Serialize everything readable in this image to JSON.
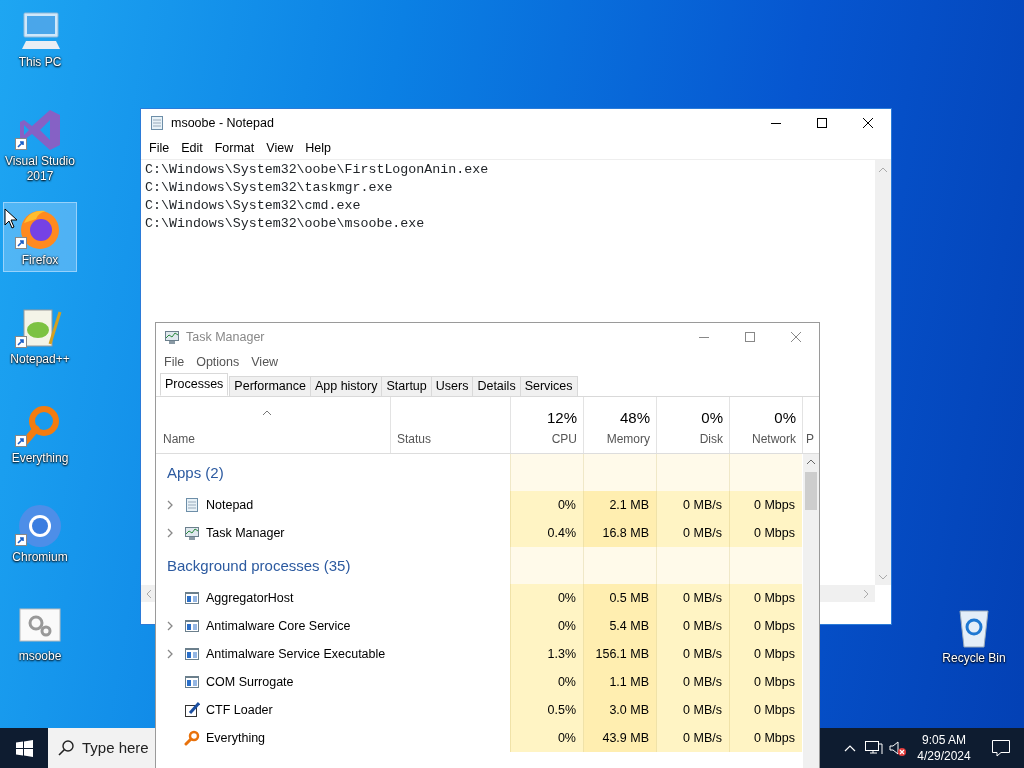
{
  "desktop_icons": [
    {
      "label": "This PC",
      "kind": "computer",
      "shortcut": false,
      "selected": false
    },
    {
      "label": "Visual Studio 2017",
      "kind": "ribbon",
      "shortcut": true,
      "selected": false
    },
    {
      "label": "Firefox",
      "kind": "fox",
      "shortcut": true,
      "selected": true
    },
    {
      "label": "Notepad++",
      "kind": "notepadpp",
      "shortcut": true,
      "selected": false
    },
    {
      "label": "Everything",
      "kind": "magnifier",
      "shortcut": true,
      "selected": false
    },
    {
      "label": "Chromium",
      "kind": "chrome",
      "shortcut": true,
      "selected": false
    },
    {
      "label": "msoobe",
      "kind": "gears",
      "shortcut": false,
      "selected": false
    }
  ],
  "recycle_bin": {
    "label": "Recycle Bin"
  },
  "notepad": {
    "title": "msoobe - Notepad",
    "menu": [
      "File",
      "Edit",
      "Format",
      "View",
      "Help"
    ],
    "lines": [
      "C:\\Windows\\System32\\oobe\\FirstLogonAnin.exe",
      "C:\\Windows\\System32\\taskmgr.exe",
      "C:\\Windows\\System32\\cmd.exe",
      "C:\\Windows\\System32\\oobe\\msoobe.exe"
    ]
  },
  "task_manager": {
    "title": "Task Manager",
    "menu": [
      "File",
      "Options",
      "View"
    ],
    "tabs": [
      {
        "label": "Processes",
        "selected": true
      },
      {
        "label": "Performance",
        "selected": false
      },
      {
        "label": "App history",
        "selected": false
      },
      {
        "label": "Startup",
        "selected": false
      },
      {
        "label": "Users",
        "selected": false
      },
      {
        "label": "Details",
        "selected": false
      },
      {
        "label": "Services",
        "selected": false
      }
    ],
    "columns": [
      {
        "label": "Name"
      },
      {
        "label": "Status"
      },
      {
        "label": "CPU",
        "usage": "12%"
      },
      {
        "label": "Memory",
        "usage": "48%"
      },
      {
        "label": "Disk",
        "usage": "0%"
      },
      {
        "label": "Network",
        "usage": "0%"
      },
      {
        "label": "P"
      }
    ],
    "groups": [
      {
        "title": "Apps (2)",
        "rows": [
          {
            "name": "Notepad",
            "kind": "notepad",
            "expandable": true,
            "values": [
              "0%",
              "2.1 MB",
              "0 MB/s",
              "0 Mbps"
            ]
          },
          {
            "name": "Task Manager",
            "kind": "monitor",
            "expandable": true,
            "values": [
              "0.4%",
              "16.8 MB",
              "0 MB/s",
              "0 Mbps"
            ]
          }
        ]
      },
      {
        "title": "Background processes (35)",
        "rows": [
          {
            "name": "AggregatorHost",
            "kind": "service",
            "expandable": false,
            "values": [
              "0%",
              "0.5 MB",
              "0 MB/s",
              "0 Mbps"
            ]
          },
          {
            "name": "Antimalware Core Service",
            "kind": "service",
            "expandable": true,
            "values": [
              "0%",
              "5.4 MB",
              "0 MB/s",
              "0 Mbps"
            ]
          },
          {
            "name": "Antimalware Service Executable",
            "kind": "service",
            "expandable": true,
            "values": [
              "1.3%",
              "156.1 MB",
              "0 MB/s",
              "0 Mbps"
            ]
          },
          {
            "name": "COM Surrogate",
            "kind": "service",
            "expandable": false,
            "values": [
              "0%",
              "1.1 MB",
              "0 MB/s",
              "0 Mbps"
            ]
          },
          {
            "name": "CTF Loader",
            "kind": "pen",
            "expandable": false,
            "values": [
              "0.5%",
              "3.0 MB",
              "0 MB/s",
              "0 Mbps"
            ]
          },
          {
            "name": "Everything",
            "kind": "magnifier",
            "expandable": false,
            "values": [
              "0%",
              "43.9 MB",
              "0 MB/s",
              "0 Mbps"
            ]
          }
        ]
      }
    ]
  },
  "taskbar": {
    "search": {
      "placeholder": "Type here"
    },
    "time": "9:05 AM",
    "date": "4/29/2024"
  }
}
